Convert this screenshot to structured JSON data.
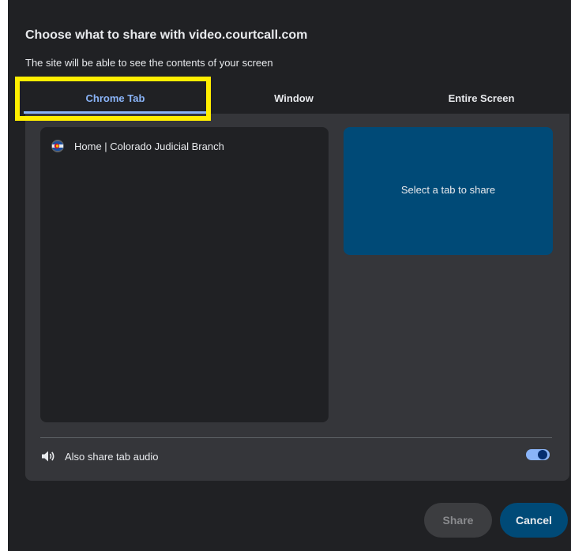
{
  "dialog": {
    "title": "Choose what to share with video.courtcall.com",
    "subtitle": "The site will be able to see the contents of your screen"
  },
  "tabs": [
    {
      "label": "Chrome Tab",
      "selected": true
    },
    {
      "label": "Window",
      "selected": false
    },
    {
      "label": "Entire Screen",
      "selected": false
    }
  ],
  "tab_list": [
    {
      "title": "Home | Colorado Judicial Branch",
      "icon": "colorado-flag-icon"
    }
  ],
  "preview": {
    "text": "Select a tab to share"
  },
  "audio": {
    "label": "Also share tab audio",
    "enabled": true
  },
  "buttons": {
    "share": "Share",
    "cancel": "Cancel"
  },
  "colors": {
    "dialog_bg": "#202124",
    "panel_bg": "#35363a",
    "accent": "#8ab4f8",
    "preview_bg": "#004a77",
    "highlight": "#ffee00"
  }
}
